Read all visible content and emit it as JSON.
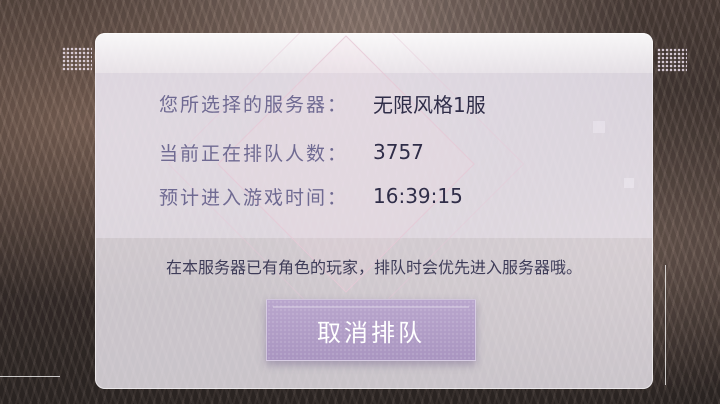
{
  "queue": {
    "server_label": "您所选择的服务器：",
    "server_value": "无限风格1服",
    "queue_label": "当前正在排队人数：",
    "queue_value": "3757",
    "eta_label": "预计进入游戏时间：",
    "eta_value": "16:39:15",
    "notice": "在本服务器已有角色的玩家，排队时会优先进入服务器哦。",
    "cancel_label": "取消排队"
  },
  "colors": {
    "label": "#6f6a92",
    "value": "#2f2d48",
    "button": "#b09dc6"
  }
}
